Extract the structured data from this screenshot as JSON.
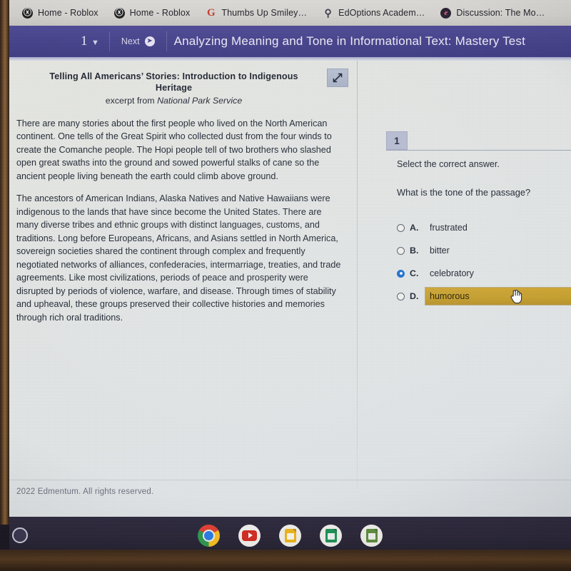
{
  "browser": {
    "tabs": [
      {
        "title": "Home - Roblox",
        "icon": "roblox-icon",
        "glyph": "ⓧ"
      },
      {
        "title": "Home - Roblox",
        "icon": "roblox-icon",
        "glyph": "ⓧ"
      },
      {
        "title": "Thumbs Up Smiley…",
        "icon": "google-icon",
        "glyph": "G"
      },
      {
        "title": "EdOptions Academ…",
        "icon": "lightbulb-icon",
        "glyph": "⚲"
      },
      {
        "title": "Discussion: The Mo…",
        "icon": "edge-icon",
        "glyph": "e"
      }
    ]
  },
  "appbar": {
    "question_number": "1",
    "chevron_icon": "chevron-down-icon",
    "next_label": "Next",
    "next_icon": "next-circle-icon",
    "title": "Analyzing Meaning and Tone in Informational Text: Mastery Test",
    "background_color": "#46428c"
  },
  "passage": {
    "title": "Telling All Americans’ Stories: Introduction to Indigenous Heritage",
    "subtitle_prefix": "excerpt from ",
    "subtitle_source": "National Park Service",
    "expand_icon": "expand-diagonal-icon",
    "paragraphs": [
      "There are many stories about the first people who lived on the North American continent. One tells of the Great Spirit who collected dust from the four winds to create the Comanche people. The Hopi people tell of two brothers who slashed open great swaths into the ground and sowed powerful stalks of cane so the ancient people living beneath the earth could climb above ground.",
      "The ancestors of American Indians, Alaska Natives and Native Hawaiians were indigenous to the lands that have since become the United States. There are many diverse tribes and ethnic groups with distinct languages, customs, and traditions. Long before Europeans, Africans, and Asians settled in North America, sovereign societies shared the continent through complex and frequently negotiated networks of alliances, confederacies, intermarriage, treaties, and trade agreements. Like most civilizations, periods of peace and prosperity were disrupted by periods of violence, warfare, and disease. Through times of stability and upheaval, these groups preserved their collective histories and memories through rich oral traditions."
    ]
  },
  "question": {
    "tab_number": "1",
    "instruction": "Select the correct answer.",
    "prompt": "What is the tone of the passage?",
    "selected_option": "C",
    "hovered_option": "D",
    "highlight_color": "#c69f2c",
    "radio_selected_color": "#1b6fd0",
    "options": [
      {
        "letter": "A.",
        "text": "frustrated"
      },
      {
        "letter": "B.",
        "text": "bitter"
      },
      {
        "letter": "C.",
        "text": "celebratory"
      },
      {
        "letter": "D.",
        "text": "humorous"
      }
    ],
    "cursor_icon": "pointing-hand-cursor"
  },
  "footer": {
    "copyright": "2022 Edmentum. All rights reserved."
  },
  "shelf": {
    "launcher_icon": "launcher-circle-icon",
    "apps": [
      {
        "name": "chrome-icon"
      },
      {
        "name": "youtube-icon"
      },
      {
        "name": "google-slides-icon"
      },
      {
        "name": "google-sheets-icon"
      },
      {
        "name": "google-forms-icon"
      }
    ]
  }
}
